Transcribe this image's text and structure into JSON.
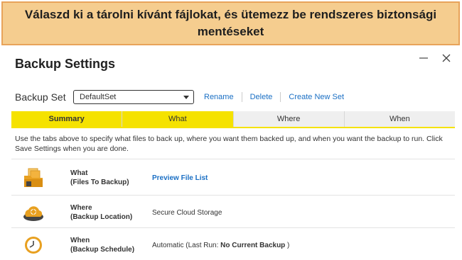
{
  "banner": {
    "text": "Válaszd ki a tárolni kívánt fájlokat, és ütemezz be rendszeres biztonsági mentéseket"
  },
  "window": {
    "title": "Backup Settings"
  },
  "backup_set": {
    "label": "Backup Set",
    "selected": "DefaultSet",
    "rename": "Rename",
    "delete": "Delete",
    "create_new": "Create New Set"
  },
  "tabs": [
    {
      "label": "Summary",
      "active": true
    },
    {
      "label": "What"
    },
    {
      "label": "Where"
    },
    {
      "label": "When"
    }
  ],
  "instructions": "Use the tabs above to specify what files to back up, where you want them backed up, and when you want the backup to run. Click Save Settings when you are done.",
  "rows": [
    {
      "icon": "files-folder-icon",
      "title": "What",
      "subtitle": "(Files To Backup)",
      "value": "Preview File List"
    },
    {
      "icon": "cloud-location-icon",
      "title": "Where",
      "subtitle": "(Backup Location)",
      "value": "Secure Cloud Storage"
    },
    {
      "icon": "clock-icon",
      "title": "When",
      "subtitle": "(Backup Schedule)",
      "value_prefix": "Automatic (Last Run: ",
      "value_bold": "No Current Backup",
      "value_suffix": " )"
    }
  ],
  "colors": {
    "banner_bg": "#f5cd8f",
    "banner_border": "#e8a35a",
    "tab_active": "#f5e200",
    "link": "#1a6fc4",
    "icon_orange": "#e8a020"
  }
}
